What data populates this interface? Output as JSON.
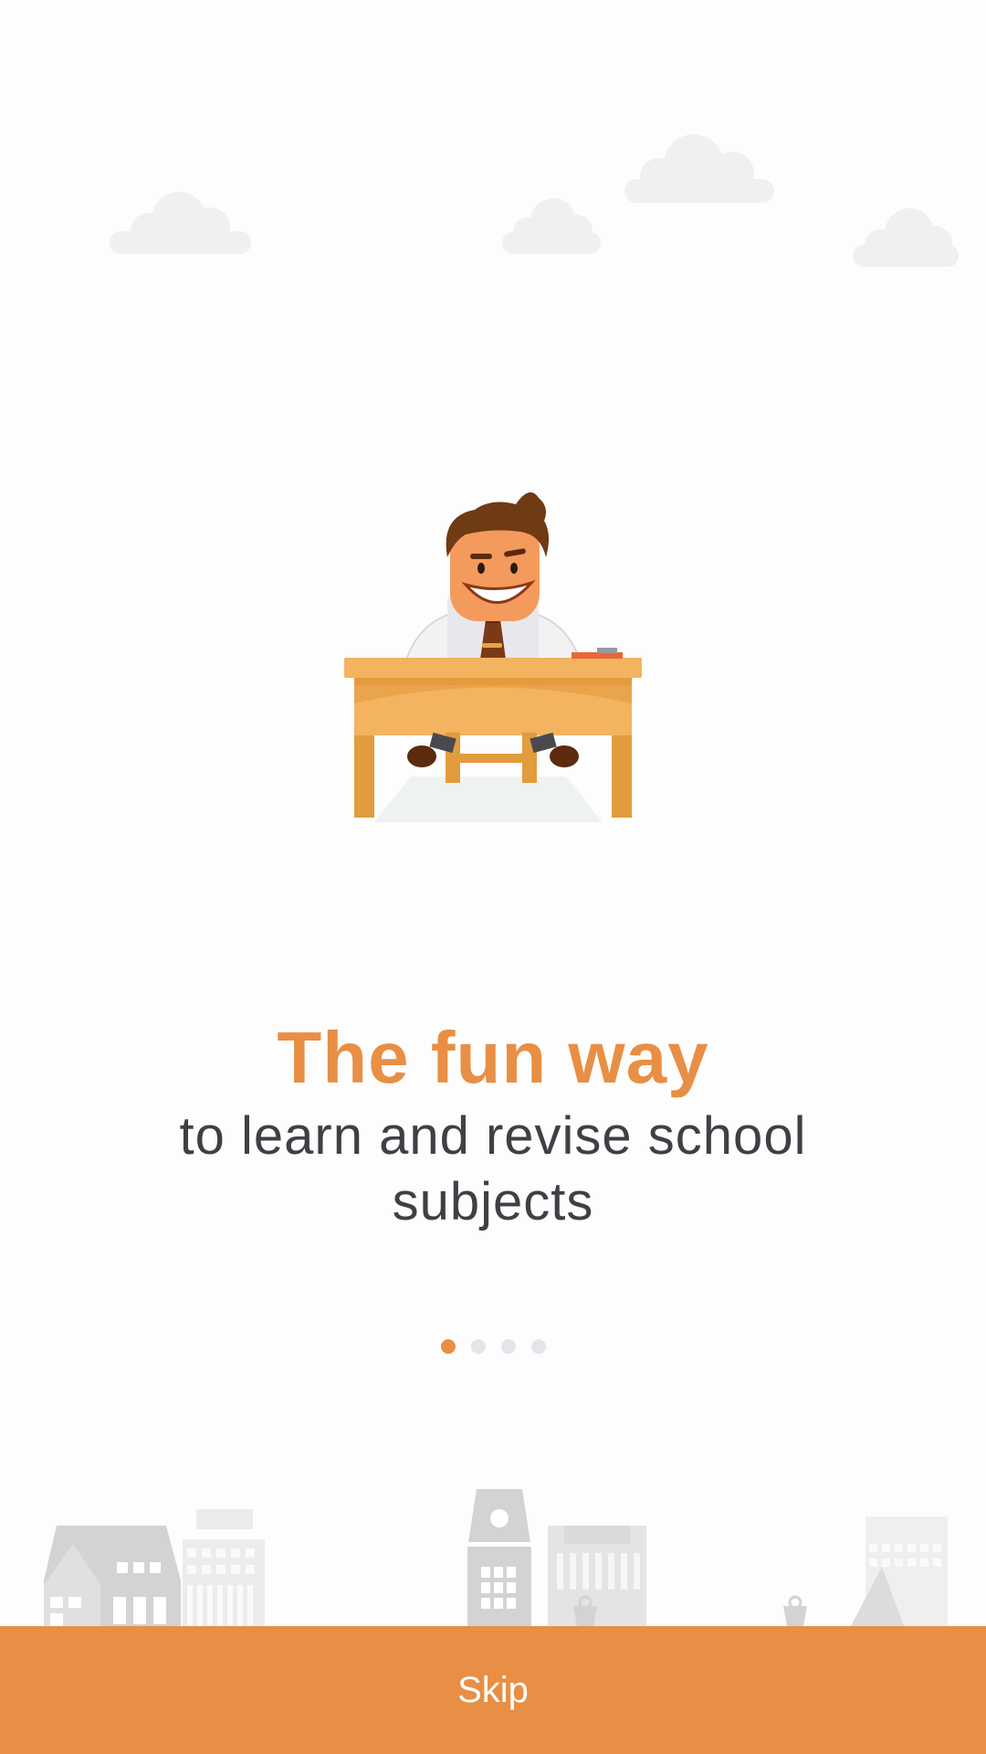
{
  "onboarding": {
    "headline": "The fun way",
    "subline": "to learn and revise school subjects",
    "pager": {
      "total": 4,
      "active_index": 0
    }
  },
  "footer": {
    "skip_label": "Skip"
  },
  "colors": {
    "accent": "#e88f45",
    "text_dark": "#3f3f45",
    "dot_inactive": "#e4e4ea",
    "cloud": "#f0f0f2"
  },
  "icons": {
    "illustration": "teacher-at-desk-illustration",
    "clouds": "cloud-icon",
    "skyline": "city-skyline-illustration"
  }
}
